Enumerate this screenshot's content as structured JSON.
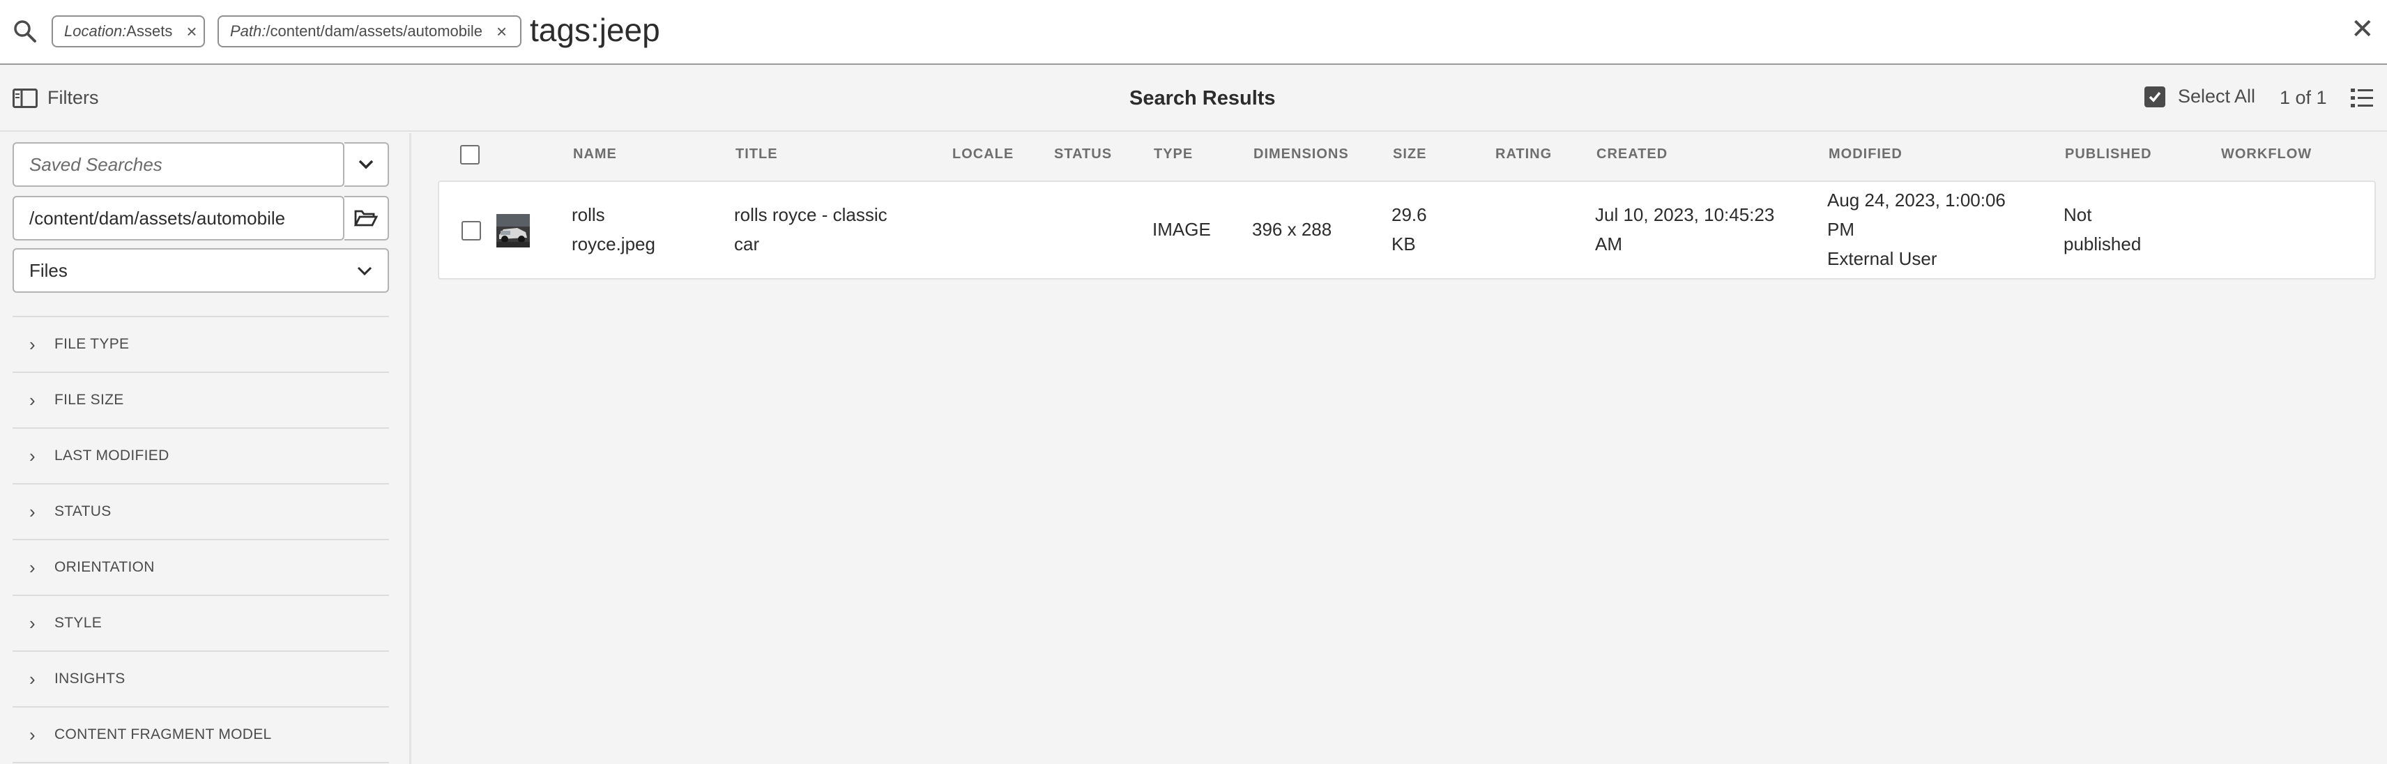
{
  "search": {
    "chips": [
      {
        "key": "Location:",
        "value": " Assets"
      },
      {
        "key": "Path:",
        "value": "/content/dam/assets/automobile"
      }
    ],
    "query": "tags:jeep"
  },
  "toolbar": {
    "filters_label": "Filters",
    "title": "Search Results",
    "select_all_label": "Select All",
    "pager": "1 of 1"
  },
  "sidebar": {
    "saved_searches_placeholder": "Saved Searches",
    "path_value": "/content/dam/assets/automobile",
    "type_value": "Files",
    "facets": [
      "FILE TYPE",
      "FILE SIZE",
      "LAST MODIFIED",
      "STATUS",
      "ORIENTATION",
      "STYLE",
      "INSIGHTS",
      "CONTENT FRAGMENT MODEL"
    ]
  },
  "table": {
    "columns": [
      "NAME",
      "TITLE",
      "LOCALE",
      "STATUS",
      "TYPE",
      "DIMENSIONS",
      "SIZE",
      "RATING",
      "CREATED",
      "MODIFIED",
      "PUBLISHED",
      "WORKFLOW"
    ],
    "rows": [
      {
        "name_line1": "rolls",
        "name_line2": "royce.jpeg",
        "title_line1": "rolls royce - classic",
        "title_line2": "car",
        "type": "IMAGE",
        "dimensions": "396 x 288",
        "size_line1": "29.6",
        "size_line2": "KB",
        "created_line1": "Jul 10, 2023, 10:45:23",
        "created_line2": "AM",
        "modified_line1": "Aug 24, 2023, 1:00:06",
        "modified_line2": "PM",
        "modified_by": "External User",
        "published_line1": "Not",
        "published_line2": "published"
      }
    ]
  }
}
